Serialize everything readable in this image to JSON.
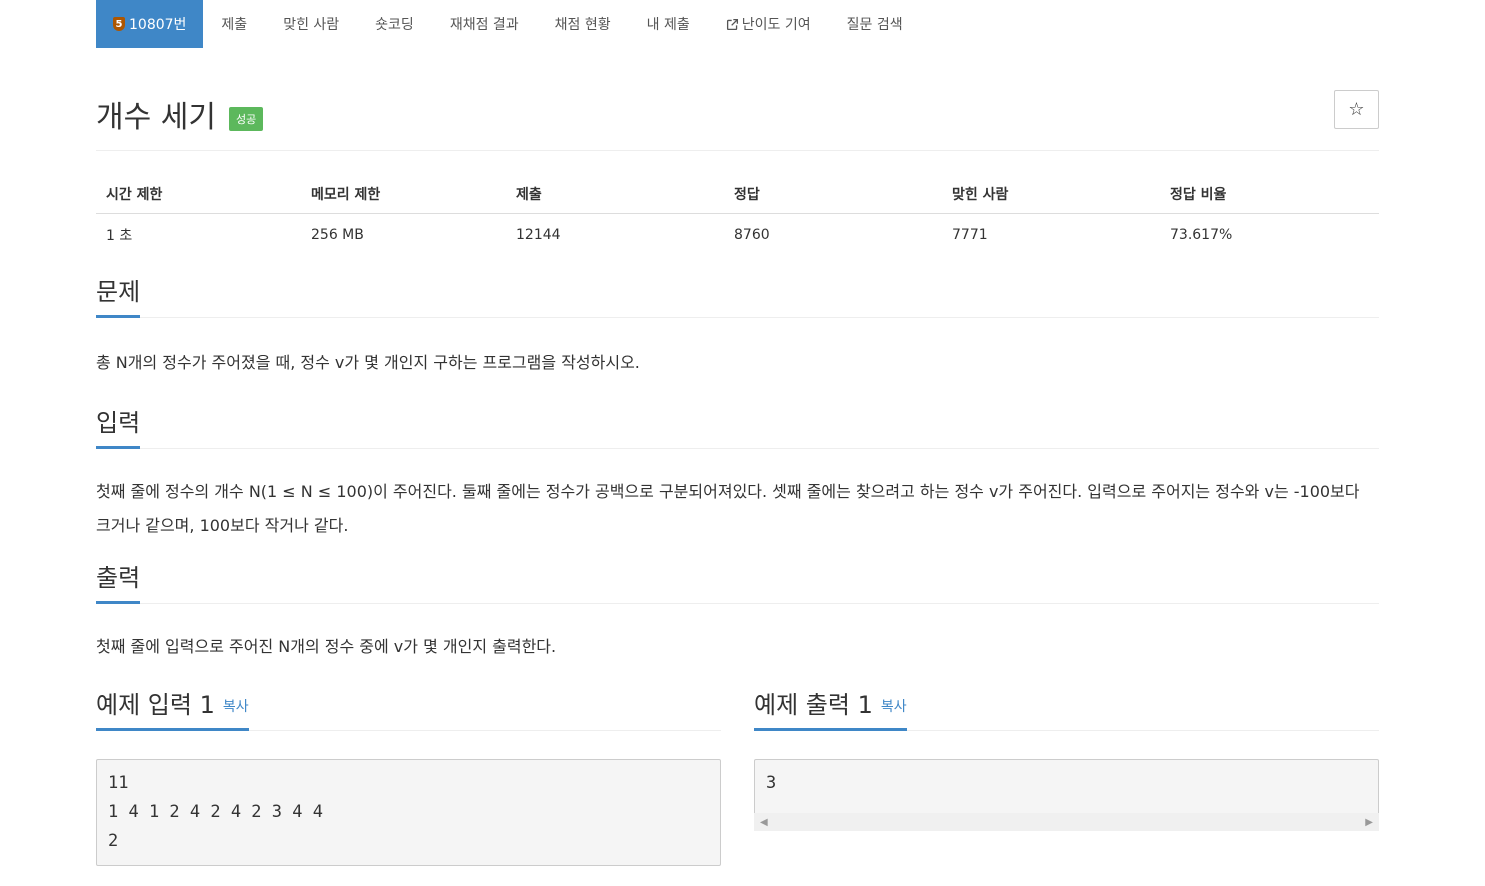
{
  "nav": {
    "problem_tier": "5",
    "problem_id": "10807번",
    "items": [
      "제출",
      "맞힌 사람",
      "숏코딩",
      "재채점 결과",
      "채점 현황",
      "내 제출",
      "난이도 기여",
      "질문 검색"
    ]
  },
  "problem": {
    "title": "개수 세기",
    "badge": "성공",
    "star": "☆"
  },
  "stats": {
    "headers": [
      "시간 제한",
      "메모리 제한",
      "제출",
      "정답",
      "맞힌 사람",
      "정답 비율"
    ],
    "values": [
      "1 초",
      "256 MB",
      "12144",
      "8760",
      "7771",
      "73.617%"
    ]
  },
  "sections": {
    "problem": {
      "title": "문제",
      "body": "총 N개의 정수가 주어졌을 때, 정수 v가 몇 개인지 구하는 프로그램을 작성하시오."
    },
    "input": {
      "title": "입력",
      "body": "첫째 줄에 정수의 개수 N(1 ≤ N ≤ 100)이 주어진다. 둘째 줄에는 정수가 공백으로 구분되어져있다. 셋째 줄에는 찾으려고 하는 정수 v가 주어진다. 입력으로 주어지는 정수와 v는 -100보다 크거나 같으며, 100보다 작거나 같다."
    },
    "output": {
      "title": "출력",
      "body": "첫째 줄에 입력으로 주어진 N개의 정수 중에 v가 몇 개인지 출력한다."
    }
  },
  "samples": {
    "input": {
      "title": "예제 입력 1",
      "copy": "복사",
      "text": "11\n1 4 1 2 4 2 4 2 3 4 4\n2"
    },
    "output": {
      "title": "예제 출력 1",
      "copy": "복사",
      "text": "3"
    }
  },
  "colors": {
    "accent": "#3f87c7",
    "badge_success": "#5cb85c",
    "tier_bronze": "#ad5600"
  }
}
